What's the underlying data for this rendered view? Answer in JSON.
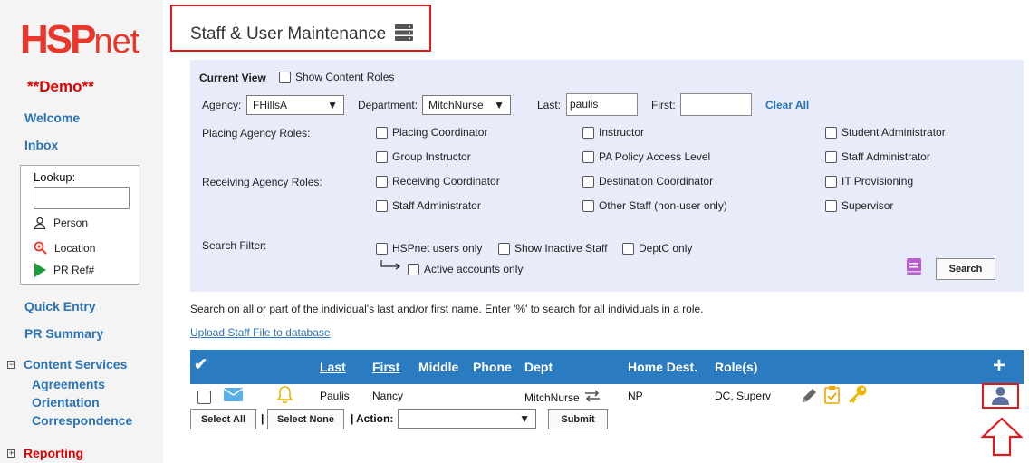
{
  "sidebar": {
    "logo_a": "HSP",
    "logo_b": "net",
    "demo": "**Demo**",
    "welcome": "Welcome",
    "inbox": "Inbox",
    "lookup": {
      "label": "Lookup:",
      "person": "Person",
      "location": "Location",
      "prref": "PR Ref#"
    },
    "quick_entry": "Quick Entry",
    "pr_summary": "PR Summary",
    "content_services": "Content Services",
    "agreements": "Agreements",
    "orientation": "Orientation",
    "correspondence": "Correspondence",
    "reporting": "Reporting",
    "tree_minus": "−",
    "tree_plus": "+"
  },
  "page_title": "Staff & User Maintenance",
  "filters": {
    "current_view": "Current View",
    "show_content_roles": "Show Content Roles",
    "agency_label": "Agency:",
    "agency_value": "FHillsA",
    "department_label": "Department:",
    "department_value": "MitchNurse",
    "last_label": "Last:",
    "last_value": "paulis",
    "first_label": "First:",
    "first_value": "",
    "clear_all": "Clear All",
    "placing_roles_label": "Placing Agency Roles:",
    "receiving_roles_label": "Receiving Agency Roles:",
    "roles": {
      "placing_coordinator": "Placing Coordinator",
      "instructor": "Instructor",
      "student_administrator": "Student Administrator",
      "group_instructor": "Group Instructor",
      "pa_policy_access_level": "PA Policy Access Level",
      "staff_administrator_placing": "Staff Administrator",
      "receiving_coordinator": "Receiving Coordinator",
      "destination_coordinator": "Destination Coordinator",
      "it_provisioning": "IT Provisioning",
      "staff_administrator_receiving": "Staff Administrator",
      "other_staff": "Other Staff (non-user only)",
      "supervisor": "Supervisor"
    },
    "search_filter_label": "Search Filter:",
    "hspnet_users_only": "HSPnet users only",
    "show_inactive_staff": "Show Inactive Staff",
    "deptc_only": "DeptC only",
    "active_accounts_only": "Active accounts only",
    "search_button": "Search"
  },
  "hint": "Search on all or part of the individual's last and/or first name. Enter '%' to search for all individuals in a role.",
  "upload_link": "Upload Staff File to database",
  "table": {
    "headers": {
      "check": "✔",
      "last": "Last",
      "first": "First",
      "middle": "Middle",
      "phone": "Phone",
      "dept": "Dept",
      "home_dest": "Home Dest.",
      "roles": "Role(s)",
      "add": "+"
    },
    "rows": [
      {
        "last": "Paulis",
        "first": "Nancy",
        "dept": "MitchNurse",
        "home_dest": "NP",
        "roles": "DC, Superv"
      }
    ]
  },
  "actions": {
    "select_all": "Select All",
    "select_none": "Select None",
    "sep1": "|",
    "sep2": "|",
    "action_label": "Action:",
    "action_value": "",
    "submit": "Submit"
  }
}
